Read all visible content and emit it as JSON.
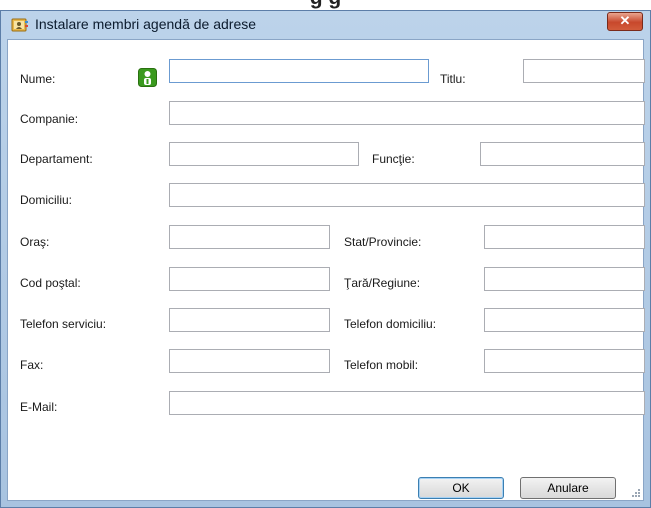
{
  "window": {
    "title": "Instalare membri agendă de adrese",
    "close_label": "✕"
  },
  "top_fragment": "g                    g",
  "form": {
    "fields": [
      {
        "id": "nume",
        "label": "Nume:",
        "value": ""
      },
      {
        "id": "titlu",
        "label": "Titlu:",
        "value": ""
      },
      {
        "id": "companie",
        "label": "Companie:",
        "value": ""
      },
      {
        "id": "departament",
        "label": "Departament:",
        "value": ""
      },
      {
        "id": "functie",
        "label": "Funcţie:",
        "value": ""
      },
      {
        "id": "domiciliu",
        "label": "Domiciliu:",
        "value": ""
      },
      {
        "id": "oras",
        "label": "Oraş:",
        "value": ""
      },
      {
        "id": "stat",
        "label": "Stat/Provincie:",
        "value": ""
      },
      {
        "id": "cod",
        "label": "Cod poştal:",
        "value": ""
      },
      {
        "id": "tara",
        "label": "Ţară/Regiune:",
        "value": ""
      },
      {
        "id": "telserv",
        "label": "Telefon serviciu:",
        "value": ""
      },
      {
        "id": "teldom",
        "label": "Telefon domiciliu:",
        "value": ""
      },
      {
        "id": "fax",
        "label": "Fax:",
        "value": ""
      },
      {
        "id": "telmob",
        "label": "Telefon mobil:",
        "value": ""
      },
      {
        "id": "email",
        "label": "E-Mail:",
        "value": ""
      }
    ]
  },
  "buttons": {
    "ok_label": "OK",
    "cancel_label": "Anulare"
  },
  "icons": {
    "app": "address-book-icon",
    "contact": "person-icon"
  },
  "colors": {
    "title_bar": "#bcd3ea",
    "close_button": "#c8482c",
    "contact_icon": "#3a9a1e",
    "focus_border": "#6b9bd1"
  }
}
